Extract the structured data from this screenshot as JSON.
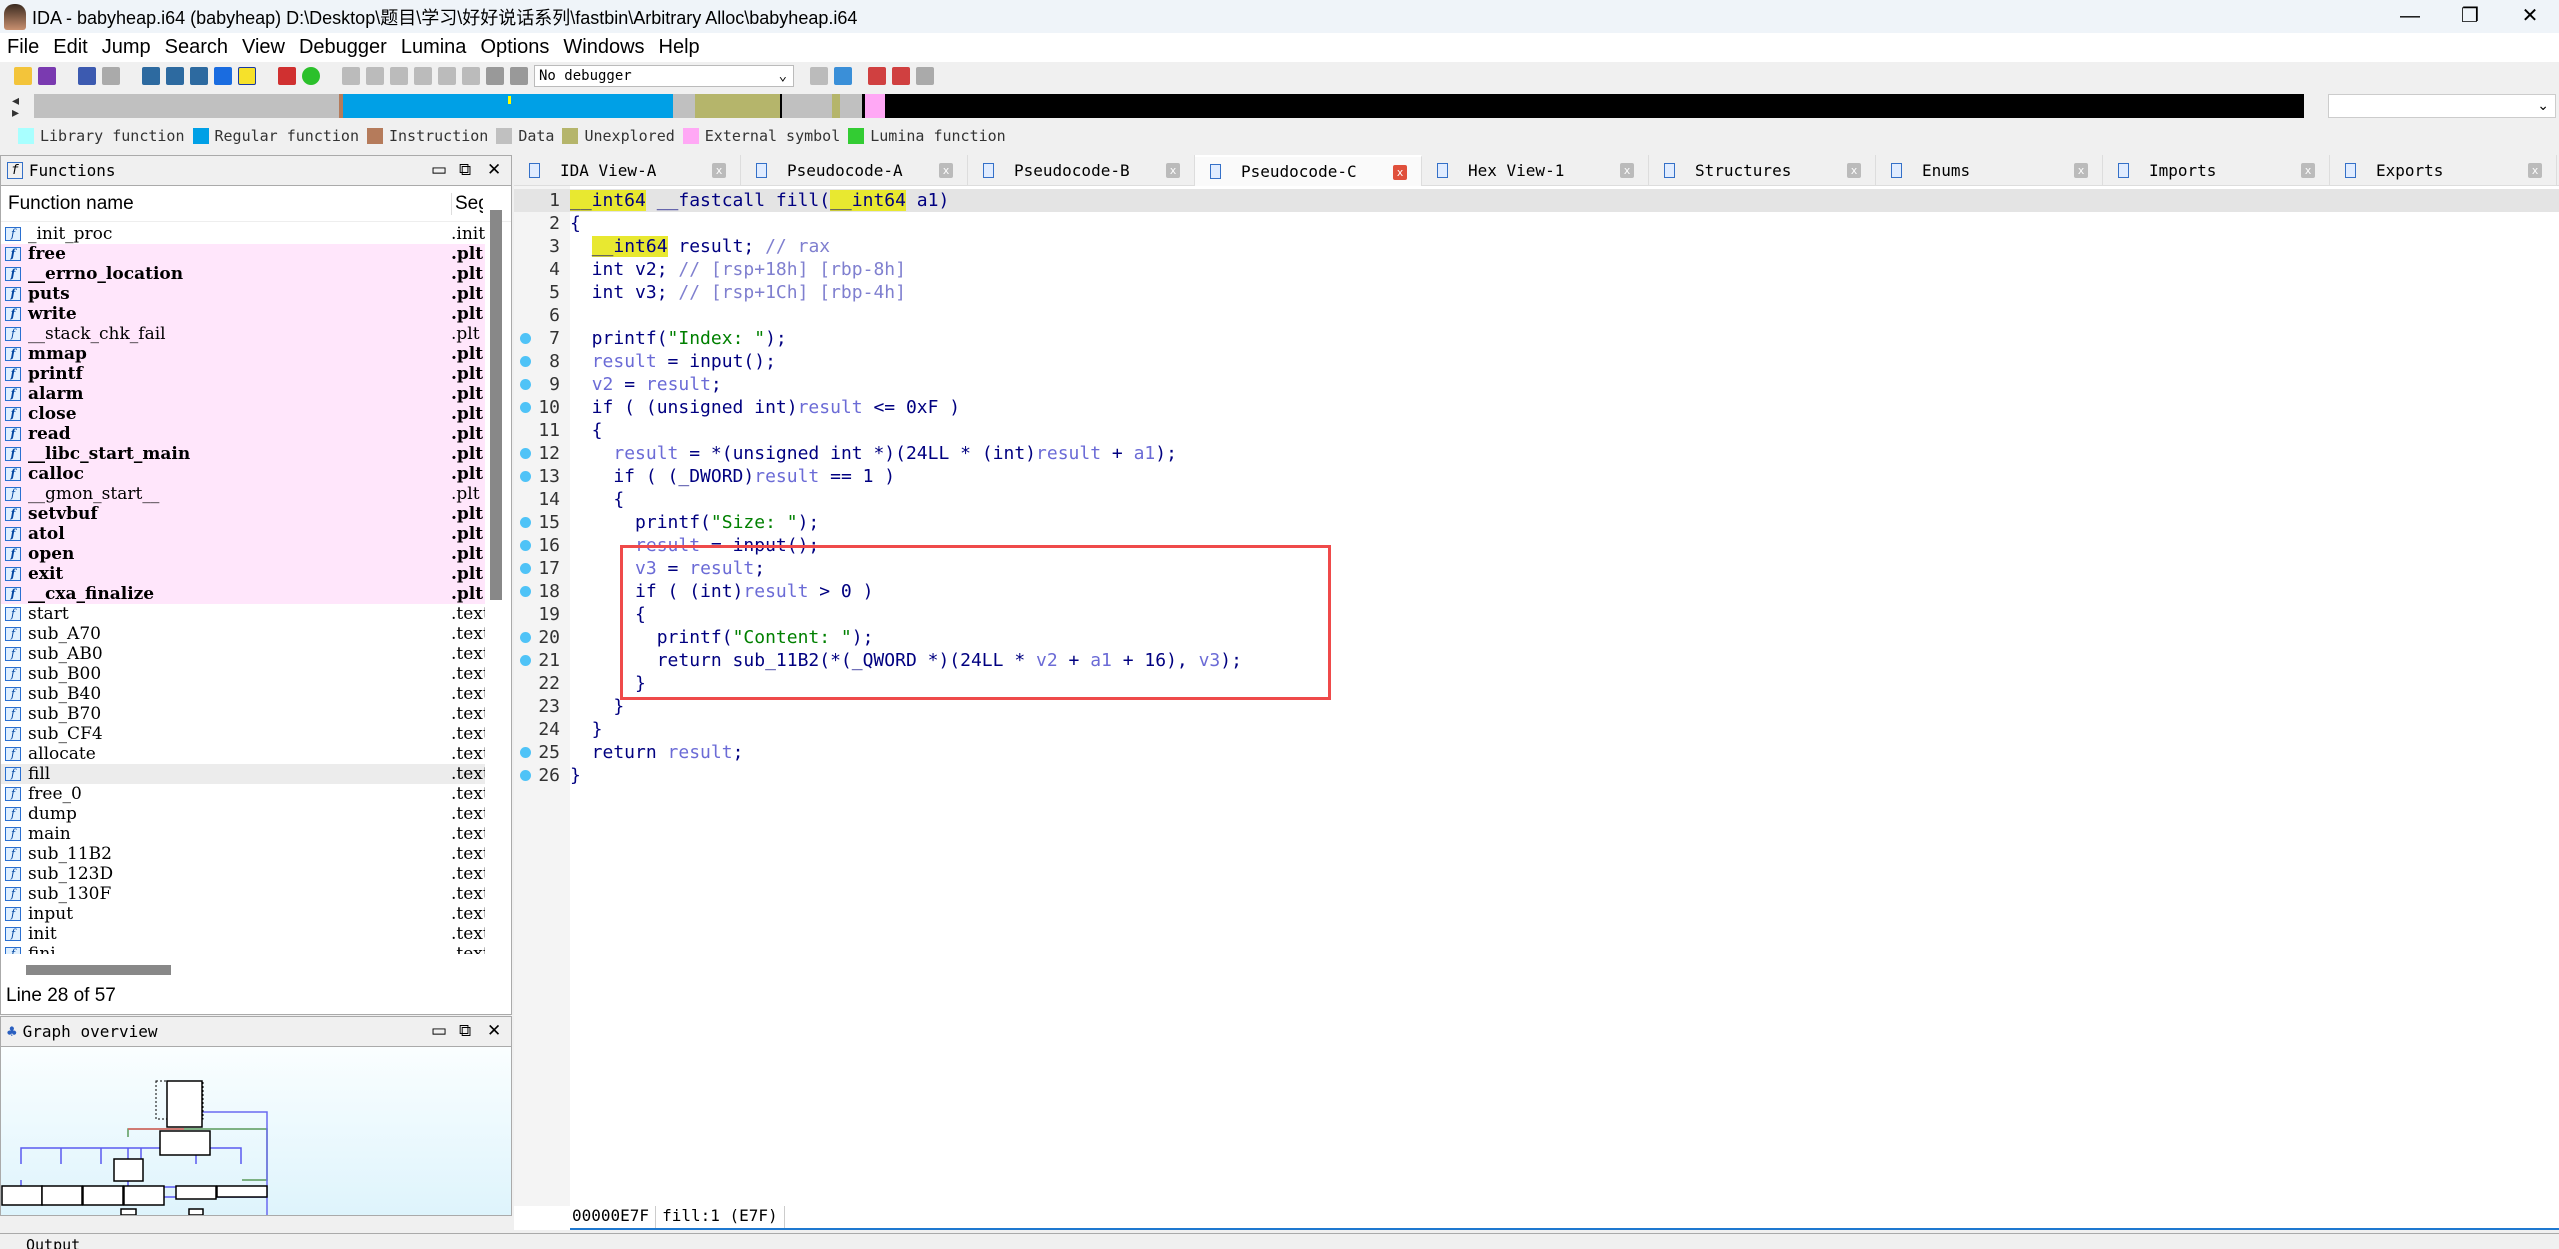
{
  "title": "IDA - babyheap.i64 (babyheap) D:\\Desktop\\题目\\学习\\好好说话系列\\fastbin\\Arbitrary Alloc\\babyheap.i64",
  "window_controls": [
    "—",
    "❐",
    "✕"
  ],
  "menu": [
    "File",
    "Edit",
    "Jump",
    "Search",
    "View",
    "Debugger",
    "Lumina",
    "Options",
    "Windows",
    "Help"
  ],
  "toolbar": {
    "debugger": "No debugger"
  },
  "legend": [
    {
      "label": "Library function",
      "color": "#a8ffff"
    },
    {
      "label": "Regular function",
      "color": "#00a0e6"
    },
    {
      "label": "Instruction",
      "color": "#b57b5b"
    },
    {
      "label": "Data",
      "color": "#c0c0c0"
    },
    {
      "label": "Unexplored",
      "color": "#b5b56b"
    },
    {
      "label": "External symbol",
      "color": "#ffa8f5"
    },
    {
      "label": "Lumina function",
      "color": "#33cc33"
    }
  ],
  "functions_panel": {
    "title": "Functions",
    "col_name": "Function name",
    "col_seg": "Segment",
    "status": "Line 28 of 57",
    "rows": [
      {
        "name": "_init_proc",
        "seg": ".init",
        "kind": "normal"
      },
      {
        "name": "free",
        "seg": ".plt",
        "kind": "ext-bold"
      },
      {
        "name": "__errno_location",
        "seg": ".plt",
        "kind": "ext-bold"
      },
      {
        "name": "puts",
        "seg": ".plt",
        "kind": "ext-bold"
      },
      {
        "name": "write",
        "seg": ".plt",
        "kind": "ext-bold"
      },
      {
        "name": "__stack_chk_fail",
        "seg": ".plt",
        "kind": "ext"
      },
      {
        "name": "mmap",
        "seg": ".plt",
        "kind": "ext-bold"
      },
      {
        "name": "printf",
        "seg": ".plt",
        "kind": "ext-bold"
      },
      {
        "name": "alarm",
        "seg": ".plt",
        "kind": "ext-bold"
      },
      {
        "name": "close",
        "seg": ".plt",
        "kind": "ext-bold"
      },
      {
        "name": "read",
        "seg": ".plt",
        "kind": "ext-bold"
      },
      {
        "name": "__libc_start_main",
        "seg": ".plt",
        "kind": "ext-bold"
      },
      {
        "name": "calloc",
        "seg": ".plt",
        "kind": "ext-bold"
      },
      {
        "name": "__gmon_start__",
        "seg": ".plt",
        "kind": "ext"
      },
      {
        "name": "setvbuf",
        "seg": ".plt",
        "kind": "ext-bold"
      },
      {
        "name": "atol",
        "seg": ".plt",
        "kind": "ext-bold"
      },
      {
        "name": "open",
        "seg": ".plt",
        "kind": "ext-bold"
      },
      {
        "name": "exit",
        "seg": ".plt",
        "kind": "ext-bold"
      },
      {
        "name": "__cxa_finalize",
        "seg": ".plt",
        "kind": "ext-bold"
      },
      {
        "name": "start",
        "seg": ".text",
        "kind": "normal"
      },
      {
        "name": "sub_A70",
        "seg": ".text",
        "kind": "normal"
      },
      {
        "name": "sub_AB0",
        "seg": ".text",
        "kind": "normal"
      },
      {
        "name": "sub_B00",
        "seg": ".text",
        "kind": "normal"
      },
      {
        "name": "sub_B40",
        "seg": ".text",
        "kind": "normal"
      },
      {
        "name": "sub_B70",
        "seg": ".text",
        "kind": "normal"
      },
      {
        "name": "sub_CF4",
        "seg": ".text",
        "kind": "normal"
      },
      {
        "name": "allocate",
        "seg": ".text",
        "kind": "normal"
      },
      {
        "name": "fill",
        "seg": ".text",
        "kind": "selected"
      },
      {
        "name": "free_0",
        "seg": ".text",
        "kind": "normal"
      },
      {
        "name": "dump",
        "seg": ".text",
        "kind": "normal"
      },
      {
        "name": "main",
        "seg": ".text",
        "kind": "normal"
      },
      {
        "name": "sub_11B2",
        "seg": ".text",
        "kind": "normal"
      },
      {
        "name": "sub_123D",
        "seg": ".text",
        "kind": "normal"
      },
      {
        "name": "sub_130F",
        "seg": ".text",
        "kind": "normal"
      },
      {
        "name": "input",
        "seg": ".text",
        "kind": "normal"
      },
      {
        "name": "init",
        "seg": ".text",
        "kind": "normal"
      },
      {
        "name": "fini",
        "seg": ".text",
        "kind": "normal"
      }
    ]
  },
  "graph_panel": {
    "title": "Graph overview"
  },
  "tabs": [
    {
      "label": "IDA View-A"
    },
    {
      "label": "Pseudocode-A"
    },
    {
      "label": "Pseudocode-B"
    },
    {
      "label": "Pseudocode-C",
      "active": true
    },
    {
      "label": "Hex View-1"
    },
    {
      "label": "Structures"
    },
    {
      "label": "Enums"
    },
    {
      "label": "Imports"
    },
    {
      "label": "Exports"
    }
  ],
  "code": [
    {
      "n": "1",
      "bp": false,
      "t": [
        [
          "__int64",
          "ty"
        ],
        [
          " __fastcall fill(",
          "plain"
        ],
        [
          "__int64",
          "ty"
        ],
        [
          " a1)",
          "plain"
        ]
      ]
    },
    {
      "n": "2",
      "bp": false,
      "t": [
        [
          "{",
          "plain"
        ]
      ]
    },
    {
      "n": "3",
      "bp": false,
      "t": [
        [
          "  ",
          "plain"
        ],
        [
          "__int64",
          "ty"
        ],
        [
          " result; ",
          "plain"
        ],
        [
          "// rax",
          "cm"
        ]
      ]
    },
    {
      "n": "4",
      "bp": false,
      "t": [
        [
          "  int v2; ",
          "plain"
        ],
        [
          "// [rsp+18h] [rbp-8h]",
          "cm"
        ]
      ]
    },
    {
      "n": "5",
      "bp": false,
      "t": [
        [
          "  int v3; ",
          "plain"
        ],
        [
          "// [rsp+1Ch] [rbp-4h]",
          "cm"
        ]
      ]
    },
    {
      "n": "6",
      "bp": false,
      "t": []
    },
    {
      "n": "7",
      "bp": true,
      "t": [
        [
          "  printf(",
          "plain"
        ],
        [
          "\"Index: \"",
          "str"
        ],
        [
          ");",
          "plain"
        ]
      ]
    },
    {
      "n": "8",
      "bp": true,
      "t": [
        [
          "  ",
          "plain"
        ],
        [
          "result",
          "var"
        ],
        [
          " = input();",
          "plain"
        ]
      ]
    },
    {
      "n": "9",
      "bp": true,
      "t": [
        [
          "  ",
          "plain"
        ],
        [
          "v2",
          "var"
        ],
        [
          " = ",
          "plain"
        ],
        [
          "result",
          "var"
        ],
        [
          ";",
          "plain"
        ]
      ]
    },
    {
      "n": "10",
      "bp": true,
      "t": [
        [
          "  if ( (unsigned int)",
          "plain"
        ],
        [
          "result",
          "var"
        ],
        [
          " <= 0xF )",
          "plain"
        ]
      ]
    },
    {
      "n": "11",
      "bp": false,
      "t": [
        [
          "  {",
          "plain"
        ]
      ]
    },
    {
      "n": "12",
      "bp": true,
      "t": [
        [
          "    ",
          "plain"
        ],
        [
          "result",
          "var"
        ],
        [
          " = *(unsigned int *)(24LL * (int)",
          "plain"
        ],
        [
          "result",
          "var"
        ],
        [
          " + ",
          "plain"
        ],
        [
          "a1",
          "var"
        ],
        [
          ");",
          "plain"
        ]
      ]
    },
    {
      "n": "13",
      "bp": true,
      "t": [
        [
          "    if ( (_DWORD)",
          "plain"
        ],
        [
          "result",
          "var"
        ],
        [
          " == 1 )",
          "plain"
        ]
      ]
    },
    {
      "n": "14",
      "bp": false,
      "t": [
        [
          "    {",
          "plain"
        ]
      ]
    },
    {
      "n": "15",
      "bp": true,
      "t": [
        [
          "      printf(",
          "plain"
        ],
        [
          "\"Size: \"",
          "str"
        ],
        [
          ");",
          "plain"
        ]
      ]
    },
    {
      "n": "16",
      "bp": true,
      "t": [
        [
          "      ",
          "plain"
        ],
        [
          "result",
          "var"
        ],
        [
          " = input();",
          "plain"
        ]
      ]
    },
    {
      "n": "17",
      "bp": true,
      "t": [
        [
          "      ",
          "plain"
        ],
        [
          "v3",
          "var"
        ],
        [
          " = ",
          "plain"
        ],
        [
          "result",
          "var"
        ],
        [
          ";",
          "plain"
        ]
      ]
    },
    {
      "n": "18",
      "bp": true,
      "t": [
        [
          "      if ( (int)",
          "plain"
        ],
        [
          "result",
          "var"
        ],
        [
          " > 0 )",
          "plain"
        ]
      ]
    },
    {
      "n": "19",
      "bp": false,
      "t": [
        [
          "      {",
          "plain"
        ]
      ]
    },
    {
      "n": "20",
      "bp": true,
      "t": [
        [
          "        printf(",
          "plain"
        ],
        [
          "\"Content: \"",
          "str"
        ],
        [
          ");",
          "plain"
        ]
      ]
    },
    {
      "n": "21",
      "bp": true,
      "t": [
        [
          "        return sub_11B2(*(_QWORD *)(24LL * ",
          "plain"
        ],
        [
          "v2",
          "var"
        ],
        [
          " + ",
          "plain"
        ],
        [
          "a1",
          "var"
        ],
        [
          " + 16), ",
          "plain"
        ],
        [
          "v3",
          "var"
        ],
        [
          ");",
          "plain"
        ]
      ]
    },
    {
      "n": "22",
      "bp": false,
      "t": [
        [
          "      }",
          "plain"
        ]
      ]
    },
    {
      "n": "23",
      "bp": false,
      "t": [
        [
          "    }",
          "plain"
        ]
      ]
    },
    {
      "n": "24",
      "bp": false,
      "t": [
        [
          "  }",
          "plain"
        ]
      ]
    },
    {
      "n": "25",
      "bp": true,
      "t": [
        [
          "  return ",
          "plain"
        ],
        [
          "result",
          "var"
        ],
        [
          ";",
          "plain"
        ]
      ]
    },
    {
      "n": "26",
      "bp": true,
      "t": [
        [
          "}",
          "plain"
        ]
      ]
    }
  ],
  "status": {
    "address": "00000E7F",
    "location": "fill:1 (E7F)"
  },
  "output": {
    "title": "Output"
  }
}
